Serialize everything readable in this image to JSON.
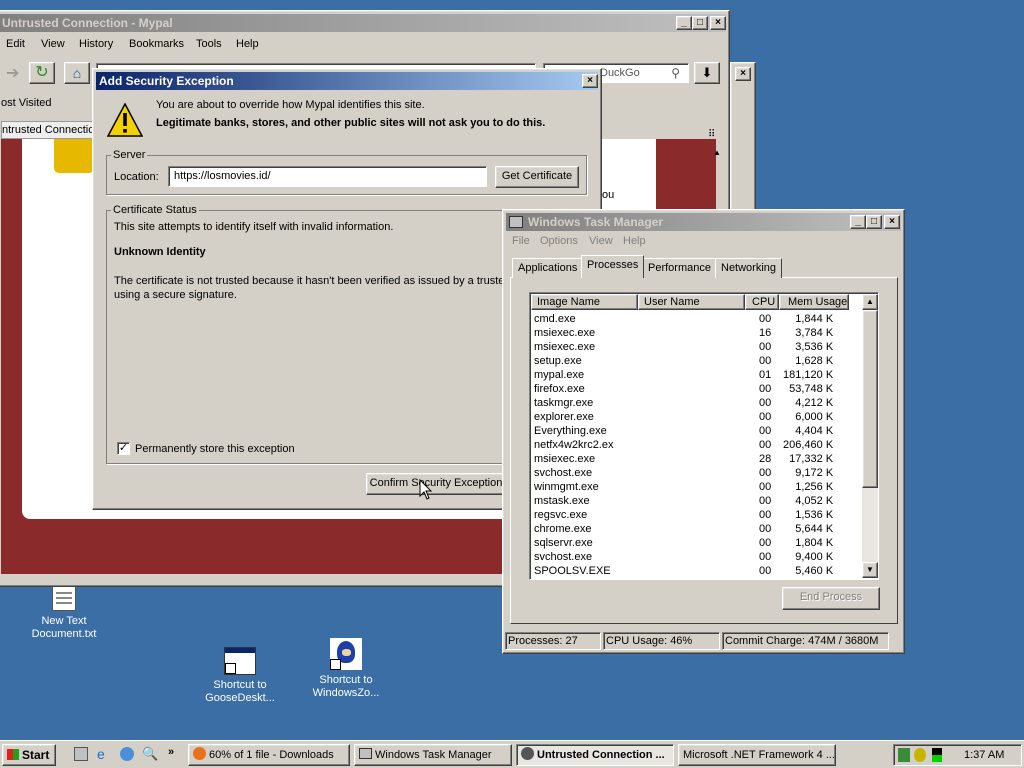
{
  "desktop": {
    "icons": [
      {
        "label1": "New Text",
        "label2": "Document.txt"
      },
      {
        "label1": "Shortcut to",
        "label2": "GooseDeskt..."
      },
      {
        "label1": "Shortcut to",
        "label2": "WindowsZo..."
      }
    ]
  },
  "browser": {
    "title": "Untrusted Connection - Mypal",
    "menu": [
      "Edit",
      "View",
      "History",
      "Bookmarks",
      "Tools",
      "Help"
    ],
    "search_placeholder": "DuckGo",
    "bookmark": "ost Visited",
    "tab_label": "ntrusted Connection",
    "partial_text": "ou"
  },
  "dialog": {
    "title": "Add Security Exception",
    "warning1": "You are about to override how Mypal identifies this site.",
    "warning2": "Legitimate banks, stores, and other public sites will not ask you to do this.",
    "server_legend": "Server",
    "location_label": "Location:",
    "location_value": "https://losmovies.id/",
    "get_cert": "Get Certificate",
    "status_legend": "Certificate Status",
    "status_line": "This site attempts to identify itself with invalid information.",
    "identity_heading": "Unknown Identity",
    "identity_text1": "The certificate is not trusted because it hasn't been verified as issued by a truste",
    "identity_text2": "using a secure signature.",
    "permanent_label": "Permanently store this exception",
    "permanent_checked": true,
    "confirm": "Confirm Security Exception"
  },
  "taskmgr": {
    "title": "Windows Task Manager",
    "menu": [
      "File",
      "Options",
      "View",
      "Help"
    ],
    "tabs": [
      "Applications",
      "Processes",
      "Performance",
      "Networking"
    ],
    "active_tab": "Processes",
    "columns": [
      "Image Name",
      "User Name",
      "CPU",
      "Mem Usage"
    ],
    "processes": [
      [
        "cmd.exe",
        "",
        "00",
        "1,844 K"
      ],
      [
        "msiexec.exe",
        "",
        "16",
        "3,784 K"
      ],
      [
        "msiexec.exe",
        "",
        "00",
        "3,536 K"
      ],
      [
        "setup.exe",
        "",
        "00",
        "1,628 K"
      ],
      [
        "mypal.exe",
        "",
        "01",
        "181,120 K"
      ],
      [
        "firefox.exe",
        "",
        "00",
        "53,748 K"
      ],
      [
        "taskmgr.exe",
        "",
        "00",
        "4,212 K"
      ],
      [
        "explorer.exe",
        "",
        "00",
        "6,000 K"
      ],
      [
        "Everything.exe",
        "",
        "00",
        "4,404 K"
      ],
      [
        "netfx4w2krc2.ex",
        "",
        "00",
        "206,460 K"
      ],
      [
        "msiexec.exe",
        "",
        "28",
        "17,332 K"
      ],
      [
        "svchost.exe",
        "",
        "00",
        "9,172 K"
      ],
      [
        "winmgmt.exe",
        "",
        "00",
        "1,256 K"
      ],
      [
        "mstask.exe",
        "",
        "00",
        "4,052 K"
      ],
      [
        "regsvc.exe",
        "",
        "00",
        "1,536 K"
      ],
      [
        "chrome.exe",
        "",
        "00",
        "5,644 K"
      ],
      [
        "sqlservr.exe",
        "",
        "00",
        "1,804 K"
      ],
      [
        "svchost.exe",
        "",
        "00",
        "9,400 K"
      ],
      [
        "SPOOLSV.EXE",
        "",
        "00",
        "5,460 K"
      ]
    ],
    "end_process": "End Process",
    "status": {
      "processes": "Processes: 27",
      "cpu": "CPU Usage: 46%",
      "commit": "Commit Charge: 474M / 3680M"
    }
  },
  "taskbar": {
    "start": "Start",
    "tasks": [
      "60% of 1 file - Downloads",
      "Windows Task Manager",
      "Untrusted Connection ...",
      "Microsoft .NET Framework 4 ..."
    ],
    "clock": "1:37 AM"
  },
  "colors": {
    "desktop": "#3a6ea5",
    "active_title": "#0a246a",
    "page_red": "#8b2a2a"
  }
}
